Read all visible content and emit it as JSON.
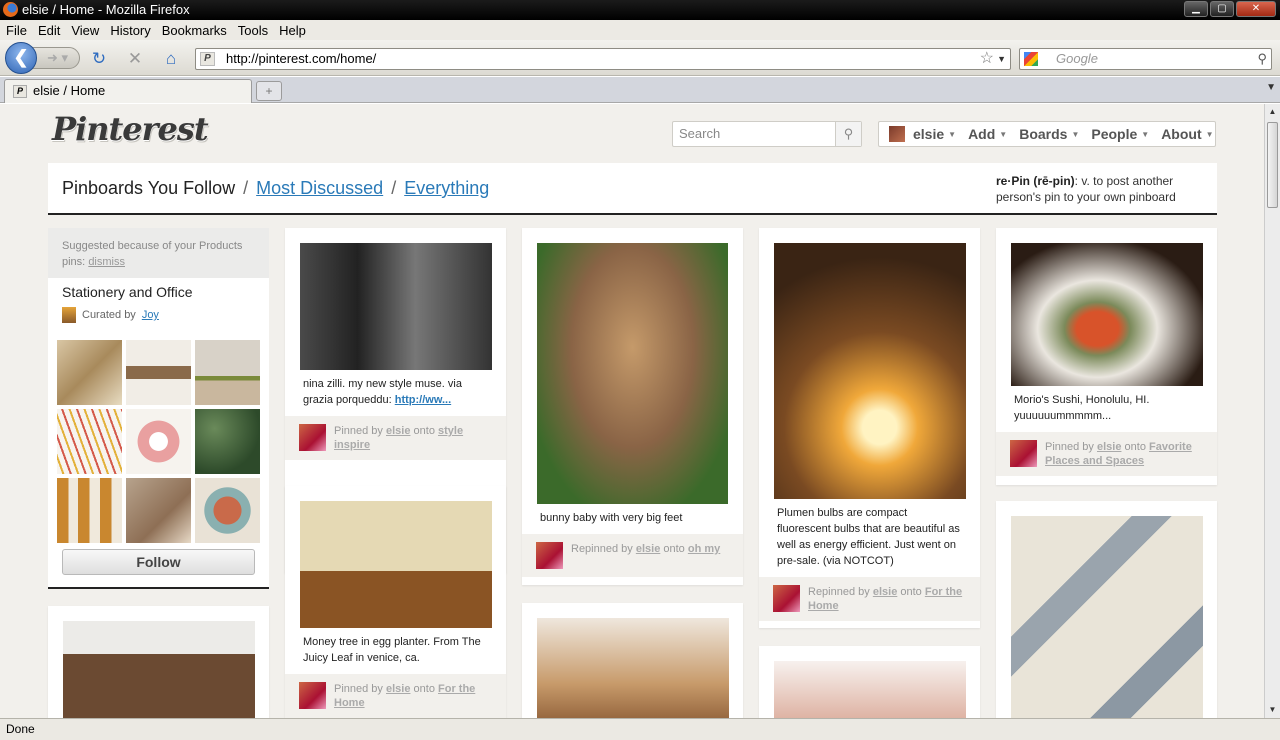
{
  "window": {
    "title": "elsie / Home - Mozilla Firefox"
  },
  "menu": [
    "File",
    "Edit",
    "View",
    "History",
    "Bookmarks",
    "Tools",
    "Help"
  ],
  "url": "http://pinterest.com/home/",
  "search_placeholder": "Google",
  "tab": {
    "title": "elsie / Home"
  },
  "status": "Done",
  "site": {
    "logo": "Pinterest",
    "search_placeholder": "Search",
    "nav": {
      "user": "elsie",
      "add": "Add",
      "boards": "Boards",
      "people": "People",
      "about": "About"
    }
  },
  "header": {
    "tab_following": "Pinboards You Follow",
    "sep": "/",
    "tab_discussed": "Most Discussed",
    "tab_everything": "Everything",
    "def_term": "re·Pin (rē-pin)",
    "def_text": ": v. to post another person's pin to your own pinboard"
  },
  "suggestion": {
    "note": "Suggested because of your Products pins:",
    "dismiss": "dismiss",
    "board": "Stationery and Office",
    "curated_by": "Curated by",
    "curator": "Joy",
    "follow": "Follow"
  },
  "pins": [
    {
      "desc": "nina zilli. my new style muse. via grazia porqueddu: ",
      "link": "http://ww...",
      "action": "Pinned by",
      "user": "elsie",
      "onto": "onto",
      "board": "style inspire"
    },
    {
      "desc": "Money tree in egg planter. From The Juicy Leaf in venice, ca.",
      "action": "Pinned by",
      "user": "elsie",
      "onto": "onto",
      "board": "For the Home"
    },
    {
      "desc": "bunny baby with very big feet",
      "action": "Repinned by",
      "user": "elsie",
      "onto": "onto",
      "board": "oh my"
    },
    {
      "desc": "Plumen bulbs are compact fluorescent bulbs that are beautiful as well as energy efficient. Just went on pre-sale. (via NOTCOT)",
      "action": "Repinned by",
      "user": "elsie",
      "onto": "onto",
      "board": "For the Home"
    },
    {
      "desc": "Morio's Sushi, Honolulu, HI. yuuuuuummmmm...",
      "action": "Pinned by",
      "user": "elsie",
      "onto": "onto",
      "board": "Favorite Places and Spaces"
    }
  ]
}
